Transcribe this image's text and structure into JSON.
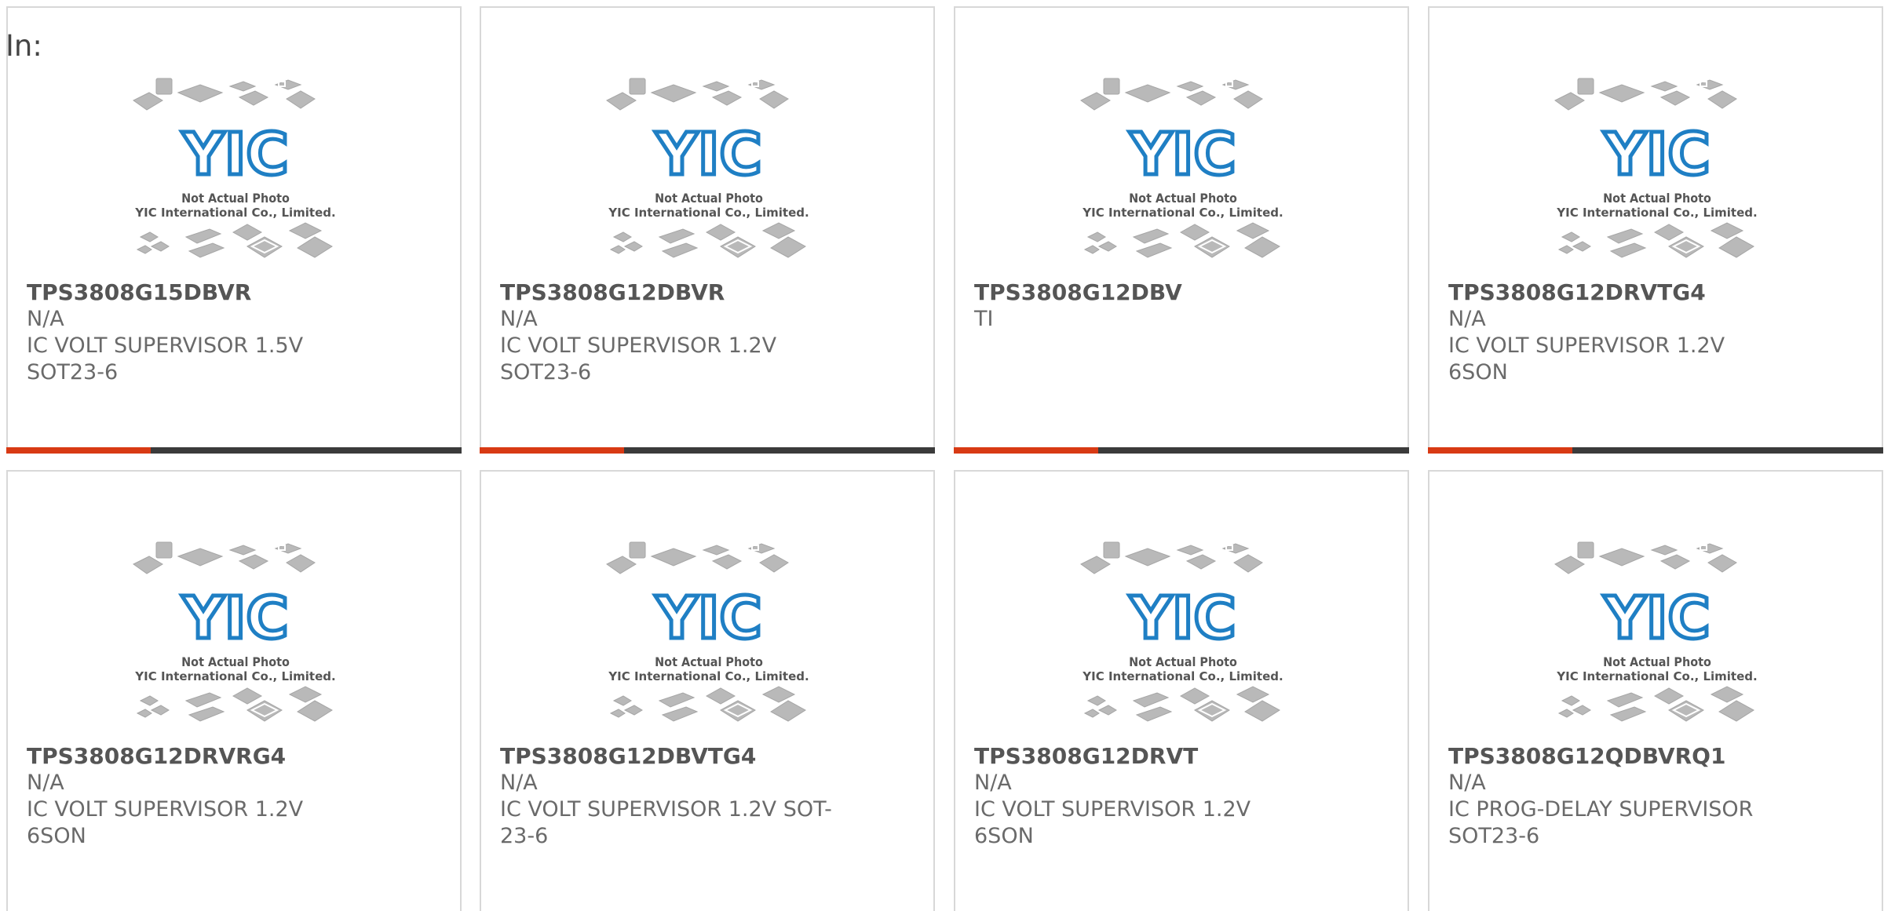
{
  "header": {
    "label": "In:"
  },
  "colors": {
    "accent": "#d83a14",
    "bar": "#3b3b3b",
    "logo": "#1f7fc4"
  },
  "placeholder": {
    "logo_text": "YIC",
    "line1": "Not Actual Photo",
    "line2": "YIC International Co., Limited."
  },
  "products": [
    {
      "part_number": "TPS3808G15DBVR",
      "manufacturer": "N/A",
      "description": "IC VOLT SUPERVISOR 1.5V SOT23-6"
    },
    {
      "part_number": "TPS3808G12DBVR",
      "manufacturer": "N/A",
      "description": "IC VOLT SUPERVISOR 1.2V SOT23-6"
    },
    {
      "part_number": "TPS3808G12DBV",
      "manufacturer": "TI",
      "description": ""
    },
    {
      "part_number": "TPS3808G12DRVTG4",
      "manufacturer": "N/A",
      "description": "IC VOLT SUPERVISOR 1.2V 6SON"
    },
    {
      "part_number": "TPS3808G12DRVRG4",
      "manufacturer": "N/A",
      "description": "IC VOLT SUPERVISOR 1.2V 6SON"
    },
    {
      "part_number": "TPS3808G12DBVTG4",
      "manufacturer": "N/A",
      "description": "IC VOLT SUPERVISOR 1.2V SOT-23-6"
    },
    {
      "part_number": "TPS3808G12DRVT",
      "manufacturer": "N/A",
      "description": "IC VOLT SUPERVISOR 1.2V 6SON"
    },
    {
      "part_number": "TPS3808G12QDBVRQ1",
      "manufacturer": "N/A",
      "description": "IC PROG-DELAY SUPERVISOR SOT23-6"
    }
  ]
}
